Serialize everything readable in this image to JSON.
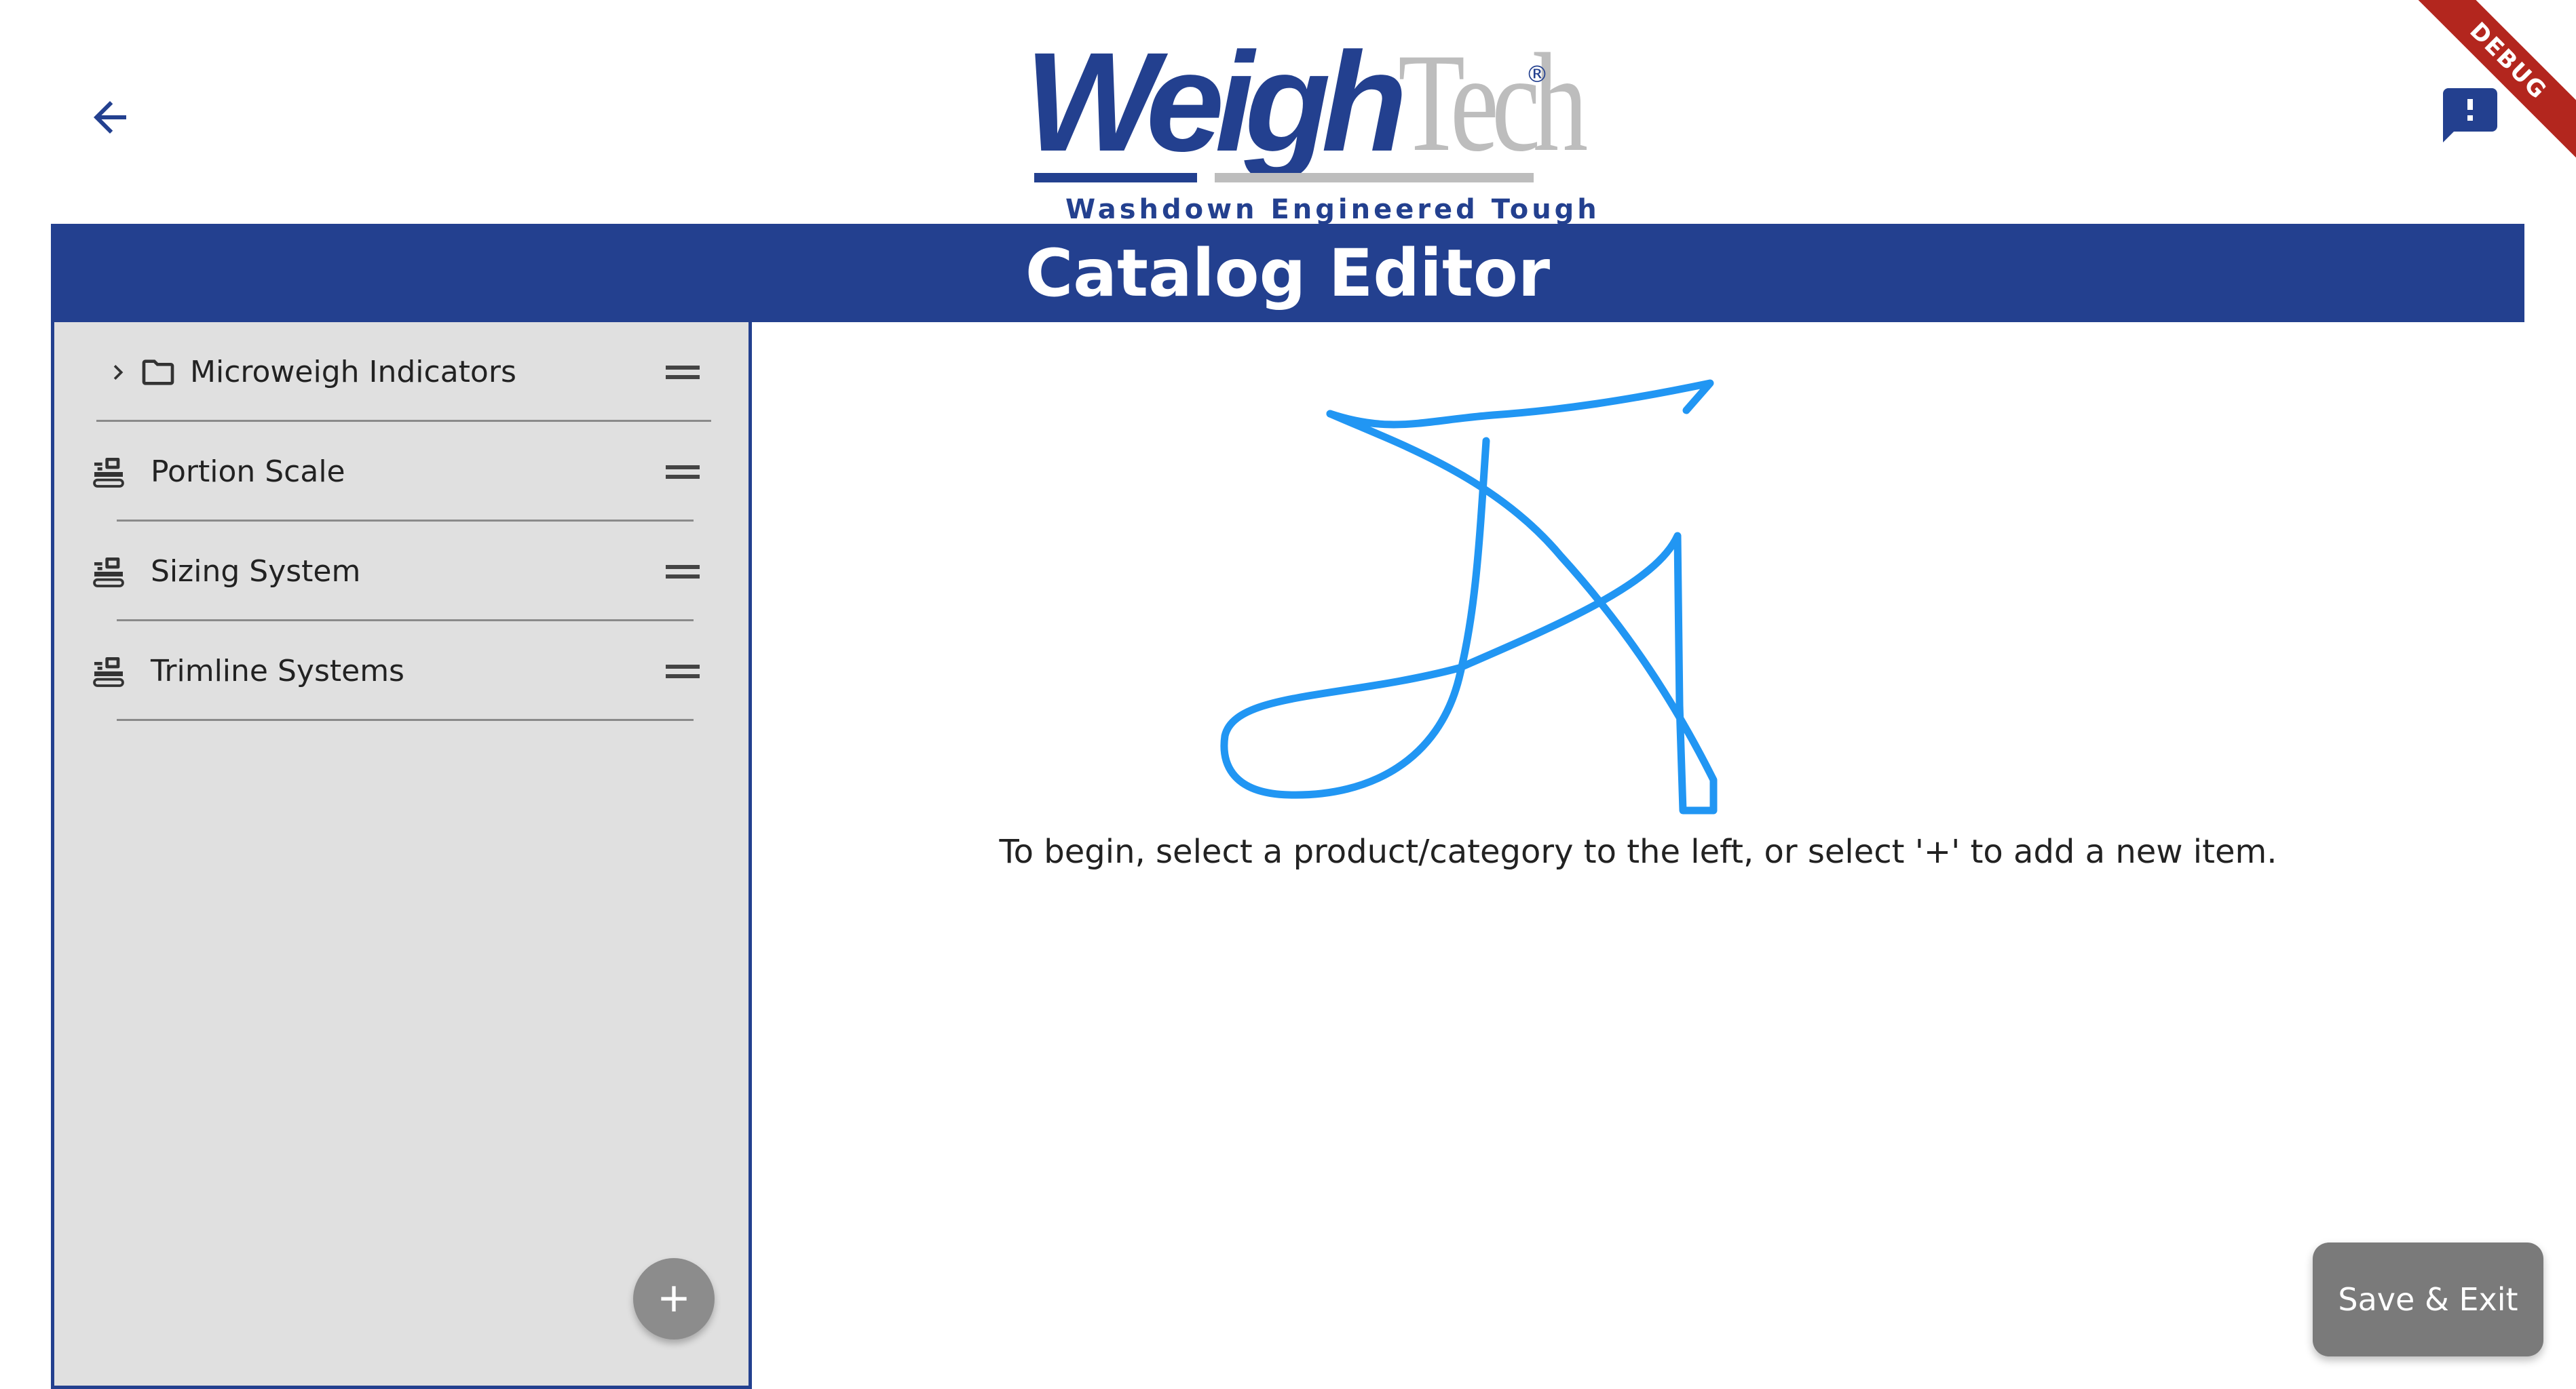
{
  "app_bar": {
    "back_icon": "arrow-back-icon",
    "feedback_icon": "feedback-icon"
  },
  "logo": {
    "wordmark_primary": "Weigh",
    "wordmark_secondary": "Tech",
    "registered_mark": "®",
    "tagline": "Washdown Engineered Tough"
  },
  "header": {
    "title": "Catalog Editor"
  },
  "sidebar": {
    "items": [
      {
        "label": "Microweigh Indicators",
        "type": "category",
        "icons": [
          "chevron-right-icon",
          "folder-icon"
        ],
        "handle_icon": "drag-handle-icon"
      },
      {
        "label": "Portion Scale",
        "type": "product",
        "icons": [
          "scale-icon"
        ],
        "handle_icon": "drag-handle-icon"
      },
      {
        "label": "Sizing System",
        "type": "product",
        "icons": [
          "scale-icon"
        ],
        "handle_icon": "drag-handle-icon"
      },
      {
        "label": "Trimline Systems",
        "type": "product",
        "icons": [
          "scale-icon"
        ],
        "handle_icon": "drag-handle-icon"
      }
    ],
    "add_icon": "plus-icon"
  },
  "main": {
    "illustration": "signature-drawing",
    "prompt": "To begin, select a product/category to the left, or select '+' to add a new item."
  },
  "actions": {
    "save_exit_label": "Save & Exit"
  },
  "debug_banner": "DEBUG",
  "colors": {
    "brand_blue": "#23408f",
    "sidebar_bg": "#e0e0e0",
    "signature_blue": "#2196f3",
    "button_gray": "#7a7a7a",
    "debug_red": "#b3261e"
  }
}
